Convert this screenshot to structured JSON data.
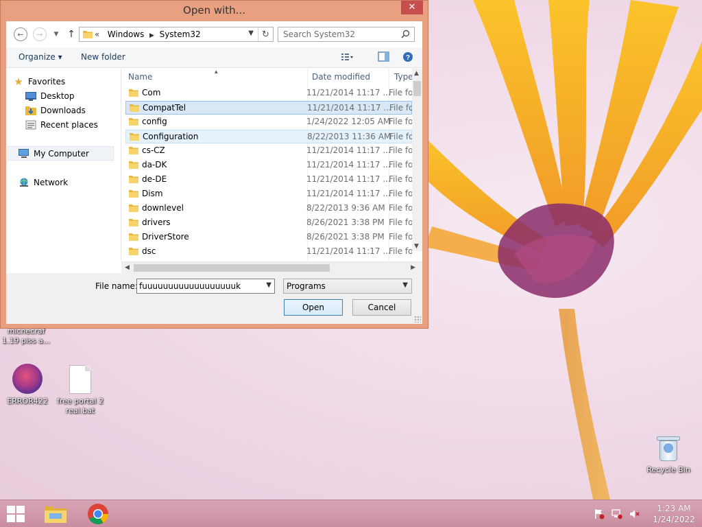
{
  "dialog": {
    "title": "Open with...",
    "close_symbol": "✕",
    "address_crumbs": [
      "Windows",
      "System32"
    ],
    "address_prefix": "«",
    "search_placeholder": "Search System32",
    "toolbar": {
      "organize": "Organize ▾",
      "new_folder": "New folder"
    },
    "nav": {
      "favorites": "Favorites",
      "desktop": "Desktop",
      "downloads": "Downloads",
      "recent": "Recent places",
      "computer": "My Computer",
      "network": "Network"
    },
    "columns": {
      "name": "Name",
      "date": "Date modified",
      "type": "Type"
    },
    "files": [
      {
        "name": "Com",
        "date": "11/21/2014 11:17 ...",
        "type": "File folder",
        "state": ""
      },
      {
        "name": "CompatTel",
        "date": "11/21/2014 11:17 ...",
        "type": "File folder",
        "state": "sel"
      },
      {
        "name": "config",
        "date": "1/24/2022 12:05 AM",
        "type": "File folder",
        "state": ""
      },
      {
        "name": "Configuration",
        "date": "8/22/2013 11:36 AM",
        "type": "File folder",
        "state": "hov"
      },
      {
        "name": "cs-CZ",
        "date": "11/21/2014 11:17 ...",
        "type": "File folder",
        "state": ""
      },
      {
        "name": "da-DK",
        "date": "11/21/2014 11:17 ...",
        "type": "File folder",
        "state": ""
      },
      {
        "name": "de-DE",
        "date": "11/21/2014 11:17 ...",
        "type": "File folder",
        "state": ""
      },
      {
        "name": "Dism",
        "date": "11/21/2014 11:17 ...",
        "type": "File folder",
        "state": ""
      },
      {
        "name": "downlevel",
        "date": "8/22/2013 9:36 AM",
        "type": "File folder",
        "state": ""
      },
      {
        "name": "drivers",
        "date": "8/26/2021 3:38 PM",
        "type": "File folder",
        "state": ""
      },
      {
        "name": "DriverStore",
        "date": "8/26/2021 3:38 PM",
        "type": "File folder",
        "state": ""
      },
      {
        "name": "dsc",
        "date": "11/21/2014 11:17 ...",
        "type": "File folder",
        "state": ""
      }
    ],
    "file_name_label": "File name:",
    "file_name_value": "fuuuuuuuuuuuuuuuuuuk",
    "filter_value": "Programs",
    "open_label": "Open",
    "cancel_label": "Cancel"
  },
  "desktop": {
    "icons": [
      {
        "label": "micnecraf 1.19 piss a...",
        "kind": "partial"
      },
      {
        "label": "ERROR422",
        "kind": "minecraft"
      },
      {
        "label": "free portal 2 real.bat",
        "kind": "file"
      },
      {
        "label": "Recycle Bin",
        "kind": "bin"
      }
    ]
  },
  "taskbar": {
    "time": "1:23 AM",
    "date": "1/24/2022"
  },
  "colors": {
    "dialog_frame": "#e9a080",
    "close": "#c74e4e",
    "selection": "#d9e8f7",
    "taskbar": "#c98da0"
  }
}
